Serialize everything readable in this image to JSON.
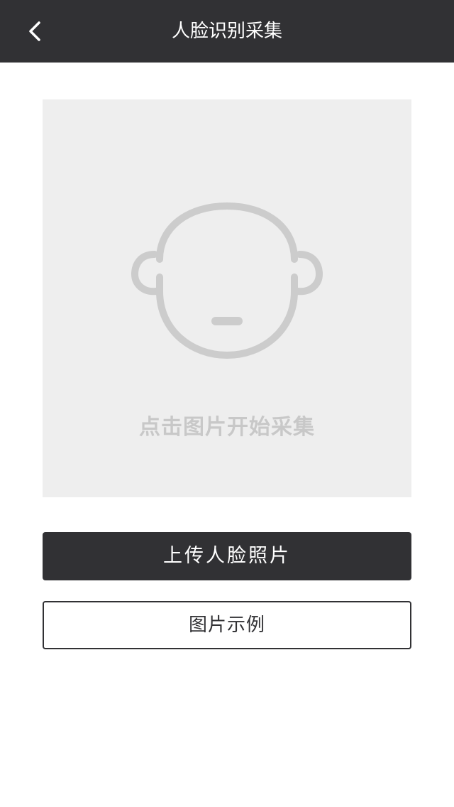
{
  "header": {
    "title": "人脸识别采集",
    "back_icon": "chevron-left-icon"
  },
  "capture": {
    "face_icon": "face-outline-icon",
    "hint": "点击图片开始采集"
  },
  "actions": {
    "upload_label": "上传人脸照片",
    "example_label": "图片示例"
  },
  "colors": {
    "navbar": "#313134",
    "capture_bg": "#eeeeee",
    "icon_gray": "#cccccc",
    "hint_gray": "#c8c8c8",
    "primary_button": "#313134"
  }
}
